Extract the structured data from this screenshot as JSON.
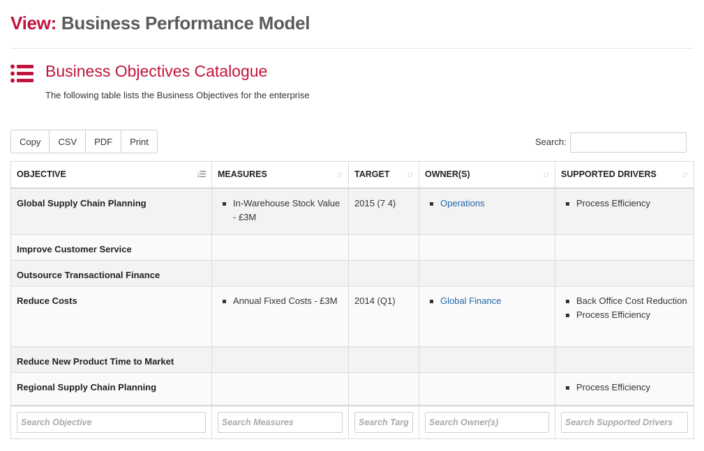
{
  "header": {
    "view_label": "View:",
    "title": "Business Performance Model"
  },
  "section": {
    "title": "Business Objectives Catalogue",
    "description": "The following table lists the Business Objectives for  the enterprise",
    "icon": "list-icon"
  },
  "toolbar": {
    "buttons": [
      "Copy",
      "CSV",
      "PDF",
      "Print"
    ]
  },
  "search": {
    "label": "Search:",
    "value": ""
  },
  "colors": {
    "accent": "#c0143c",
    "title_grey": "#5b5b5b",
    "link": "#2266aa"
  },
  "table": {
    "columns": [
      {
        "label": "OBJECTIVE",
        "sort": "sorted-ascending"
      },
      {
        "label": "MEASURES",
        "sort": "sortable"
      },
      {
        "label": "TARGET",
        "sort": "sortable"
      },
      {
        "label": "OWNER(S)",
        "sort": "sortable"
      },
      {
        "label": "SUPPORTED DRIVERS",
        "sort": "sortable"
      }
    ],
    "rows": [
      {
        "objective": "Global Supply Chain Planning",
        "measures": [
          "In-Warehouse Stock Value - £3M"
        ],
        "target": "2015 (7 4)",
        "owners": [
          "Operations"
        ],
        "drivers": [
          "Process Efficiency"
        ]
      },
      {
        "objective": "Improve Customer Service",
        "measures": [],
        "target": "",
        "owners": [],
        "drivers": []
      },
      {
        "objective": "Outsource Transactional Finance",
        "measures": [],
        "target": "",
        "owners": [],
        "drivers": []
      },
      {
        "objective": "Reduce Costs",
        "measures": [
          "Annual Fixed Costs - £3M"
        ],
        "target": "2014 (Q1)",
        "owners": [
          "Global Finance"
        ],
        "drivers": [
          "Back Office Cost Reduction",
          "Process Efficiency"
        ]
      },
      {
        "objective": "Reduce New Product Time to Market",
        "measures": [],
        "target": "",
        "owners": [],
        "drivers": []
      },
      {
        "objective": "Regional Supply Chain Planning",
        "measures": [],
        "target": "",
        "owners": [],
        "drivers": [
          "Process Efficiency"
        ]
      }
    ],
    "filters": [
      "Search Objective",
      "Search Measures",
      "Search Target",
      "Search Owner(s)",
      "Search Supported Drivers"
    ]
  }
}
